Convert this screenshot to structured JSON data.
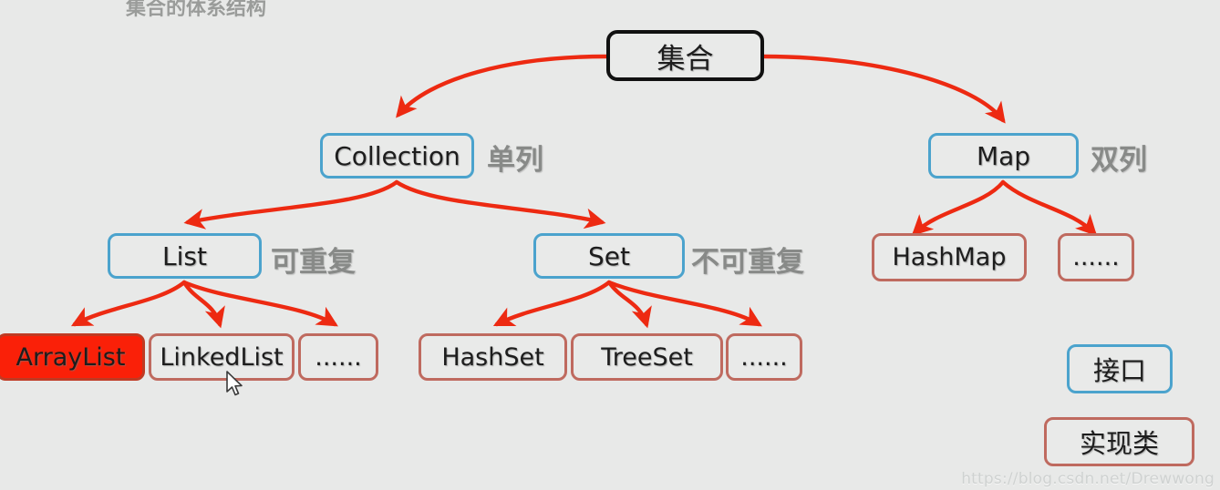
{
  "diagram": {
    "title_cropped": "集合的体系结构",
    "background_color": "#e8e9e8",
    "arrow_color": "#ed2a12",
    "interface_border_color": "#4ba3cd",
    "impl_border_color": "#bf6a5f",
    "root_border_color": "#111111",
    "highlight_color": "#fa2008",
    "annotation_color": "#888a88"
  },
  "nodes": {
    "root": {
      "label": "集合",
      "type": "root"
    },
    "collection": {
      "label": "Collection",
      "type": "interface"
    },
    "map": {
      "label": "Map",
      "type": "interface"
    },
    "list": {
      "label": "List",
      "type": "interface"
    },
    "set": {
      "label": "Set",
      "type": "interface"
    },
    "array_list": {
      "label": "ArrayList",
      "type": "impl",
      "highlighted": true
    },
    "linked_list": {
      "label": "LinkedList",
      "type": "impl"
    },
    "list_more": {
      "label": "......",
      "type": "impl"
    },
    "hash_set": {
      "label": "HashSet",
      "type": "impl"
    },
    "tree_set": {
      "label": "TreeSet",
      "type": "impl"
    },
    "set_more": {
      "label": "......",
      "type": "impl"
    },
    "hash_map": {
      "label": "HashMap",
      "type": "impl"
    },
    "map_more": {
      "label": "......",
      "type": "impl"
    }
  },
  "annotations": {
    "collection": "单列",
    "map": "双列",
    "list": "可重复",
    "set": "不可重复"
  },
  "legend": {
    "interface": "接口",
    "implementation": "实现类"
  },
  "watermark": "https://blog.csdn.net/Drewwong"
}
